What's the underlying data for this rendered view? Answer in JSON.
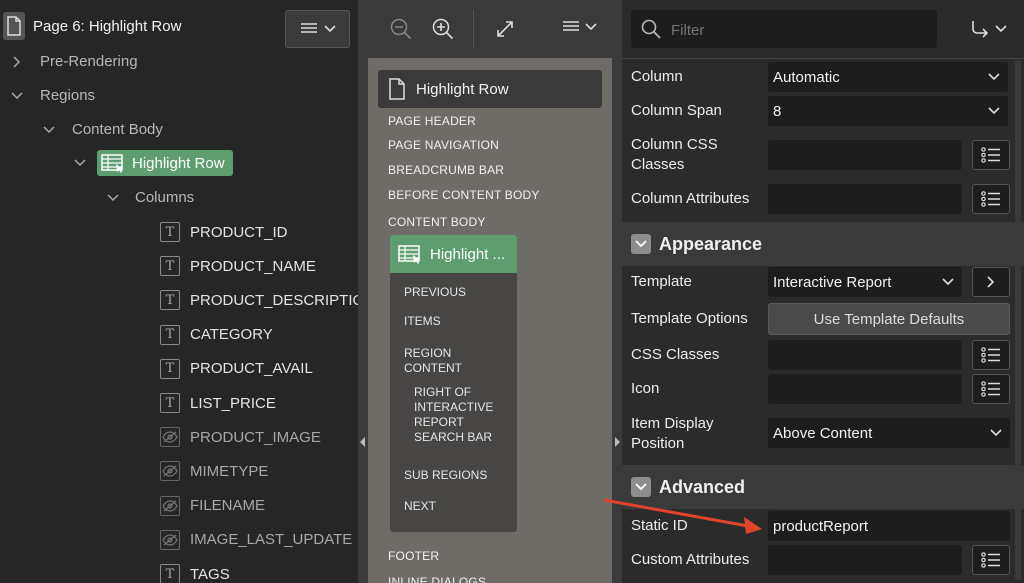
{
  "left": {
    "page_title": "Page 6: Highlight Row",
    "tree": {
      "pre_rendering": "Pre-Rendering",
      "regions": "Regions",
      "content_body": "Content Body",
      "highlight_row": "Highlight Row",
      "columns": "Columns"
    },
    "columns": [
      {
        "name": "PRODUCT_ID",
        "hidden": false
      },
      {
        "name": "PRODUCT_NAME",
        "hidden": false
      },
      {
        "name": "PRODUCT_DESCRIPTION",
        "hidden": false
      },
      {
        "name": "CATEGORY",
        "hidden": false
      },
      {
        "name": "PRODUCT_AVAIL",
        "hidden": false
      },
      {
        "name": "LIST_PRICE",
        "hidden": false
      },
      {
        "name": "PRODUCT_IMAGE",
        "hidden": true
      },
      {
        "name": "MIMETYPE",
        "hidden": true
      },
      {
        "name": "FILENAME",
        "hidden": true
      },
      {
        "name": "IMAGE_LAST_UPDATE",
        "hidden": true
      },
      {
        "name": "TAGS",
        "hidden": false
      }
    ]
  },
  "middle": {
    "page_label": "Highlight Row",
    "positions": [
      "PAGE HEADER",
      "PAGE NAVIGATION",
      "BREADCRUMB BAR",
      "BEFORE CONTENT BODY",
      "CONTENT BODY",
      "FOOTER",
      "INLINE DIALOGS"
    ],
    "region_title": "Highlight ...",
    "region_slots": [
      "PREVIOUS",
      "ITEMS",
      "REGION CONTENT",
      "RIGHT OF INTERACTIVE REPORT SEARCH BAR",
      "SUB REGIONS",
      "NEXT"
    ]
  },
  "right": {
    "filter_placeholder": "Filter",
    "props": {
      "column_label": "Column",
      "column_value": "Automatic",
      "column_span_label": "Column Span",
      "column_span_value": "8",
      "column_css_label": "Column CSS Classes",
      "column_attr_label": "Column Attributes"
    },
    "appearance": {
      "title": "Appearance",
      "template_label": "Template",
      "template_value": "Interactive Report",
      "template_options_label": "Template Options",
      "template_options_button": "Use Template Defaults",
      "css_classes_label": "CSS Classes",
      "icon_label": "Icon",
      "item_display_label": "Item Display Position",
      "item_display_value": "Above Content"
    },
    "advanced": {
      "title": "Advanced",
      "static_id_label": "Static ID",
      "static_id_value": "productReport",
      "custom_attr_label": "Custom Attributes"
    }
  },
  "colors": {
    "accent_green": "#5e9e6e",
    "annotation_arrow": "#e0452b"
  }
}
